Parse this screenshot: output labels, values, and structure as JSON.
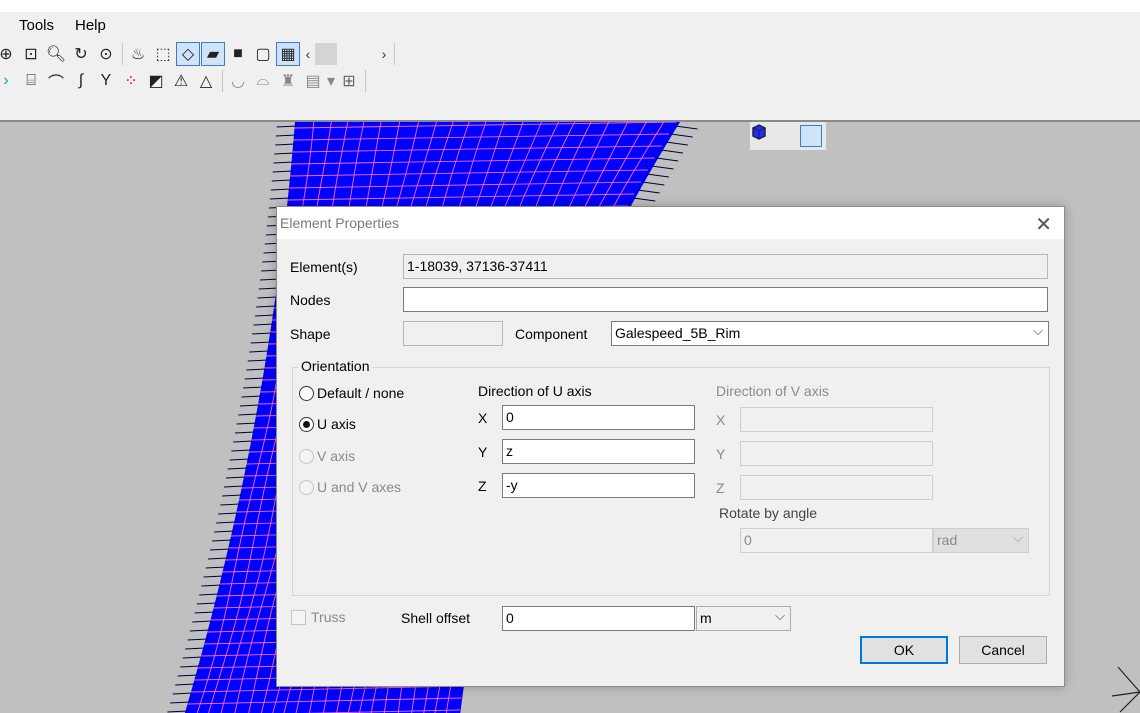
{
  "menu": {
    "items": [
      "Tools",
      "Help"
    ]
  },
  "dialog": {
    "title": "Element Properties",
    "elements_label": "Element(s)",
    "elements_value": "1-18039, 37136-37411",
    "nodes_label": "Nodes",
    "nodes_value": "",
    "shape_label": "Shape",
    "shape_value": "",
    "component_label": "Component",
    "component_value": "Galespeed_5B_Rim",
    "orientation": {
      "legend": "Orientation",
      "options": [
        "Default / none",
        "U axis",
        "V axis",
        "U and V axes"
      ],
      "selected": "U axis",
      "u_axis_heading": "Direction of U axis",
      "v_axis_heading": "Direction of V axis",
      "x_label": "X",
      "y_label": "Y",
      "z_label": "Z",
      "u_x": "0",
      "u_y": "z",
      "u_z": "-y",
      "v_x": "",
      "v_y": "",
      "v_z": "",
      "rotate_label": "Rotate by angle",
      "rotate_value": "0",
      "rotate_unit": "rad"
    },
    "truss_label": "Truss",
    "shell_offset_label": "Shell offset",
    "shell_offset_value": "0",
    "shell_offset_unit": "m",
    "ok_label": "OK",
    "cancel_label": "Cancel"
  },
  "colors": {
    "mesh_fill": "#0000ff",
    "mesh_lines": "#ff66cc",
    "viewport_bg": "#c0c0c0"
  },
  "toolbar": {
    "row1_icons": [
      "pan-icon",
      "zoom-box-icon",
      "zoom-icon",
      "rotate-icon",
      "zoom-fit-icon",
      "render-icon",
      "select-tool-icon",
      "wireframe-view-icon",
      "shaded-view-icon",
      "solid-view-icon",
      "box-view-icon",
      "mesh-view-icon"
    ],
    "row2_icons": [
      "arrow-icon",
      "cylinder-icon",
      "arch-icon",
      "curve-icon",
      "branch-icon",
      "points-icon",
      "layers-icon",
      "triangle-mesh-icon",
      "triangle-icon",
      "bowl-icon",
      "dish-icon",
      "hull-icon",
      "film-icon",
      "table-icon"
    ]
  }
}
